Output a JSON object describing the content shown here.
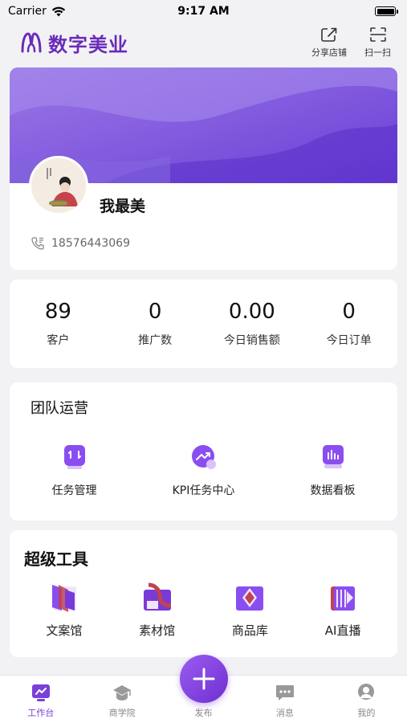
{
  "status_bar": {
    "carrier": "Carrier",
    "time": "9:17 AM"
  },
  "header": {
    "brand_title": "数字美业",
    "actions": [
      {
        "label": "分享店铺",
        "icon": "share-icon"
      },
      {
        "label": "扫一扫",
        "icon": "scan-icon"
      }
    ]
  },
  "profile": {
    "name": "我最美",
    "phone": "18576443069",
    "accent_colors": [
      "#8a5cf0",
      "#6a3bd6"
    ]
  },
  "stats": [
    {
      "value": "89",
      "label": "客户"
    },
    {
      "value": "0",
      "label": "推广数"
    },
    {
      "value": "0.00",
      "label": "今日销售额"
    },
    {
      "value": "0",
      "label": "今日订单"
    }
  ],
  "team": {
    "title": "团队运营",
    "items": [
      {
        "label": "任务管理",
        "icon": "task-icon"
      },
      {
        "label": "KPI任务中心",
        "icon": "kpi-trend-icon"
      },
      {
        "label": "数据看板",
        "icon": "data-board-icon"
      }
    ]
  },
  "tools": {
    "title": "超级工具",
    "items": [
      {
        "label": "文案馆",
        "icon": "copywriting-icon"
      },
      {
        "label": "素材馆",
        "icon": "material-icon"
      },
      {
        "label": "商品库",
        "icon": "product-library-icon"
      },
      {
        "label": "AI直播",
        "icon": "ai-live-icon"
      }
    ]
  },
  "tab_bar": {
    "items": [
      {
        "label": "工作台",
        "icon": "workbench-icon",
        "active": true
      },
      {
        "label": "商学院",
        "icon": "graduation-cap-icon",
        "active": false
      },
      {
        "label": "发布",
        "icon": "plus-icon",
        "active": false
      },
      {
        "label": "消息",
        "icon": "message-icon",
        "active": false
      },
      {
        "label": "我的",
        "icon": "user-icon",
        "active": false
      }
    ],
    "active_color": "#7b3fd8"
  }
}
